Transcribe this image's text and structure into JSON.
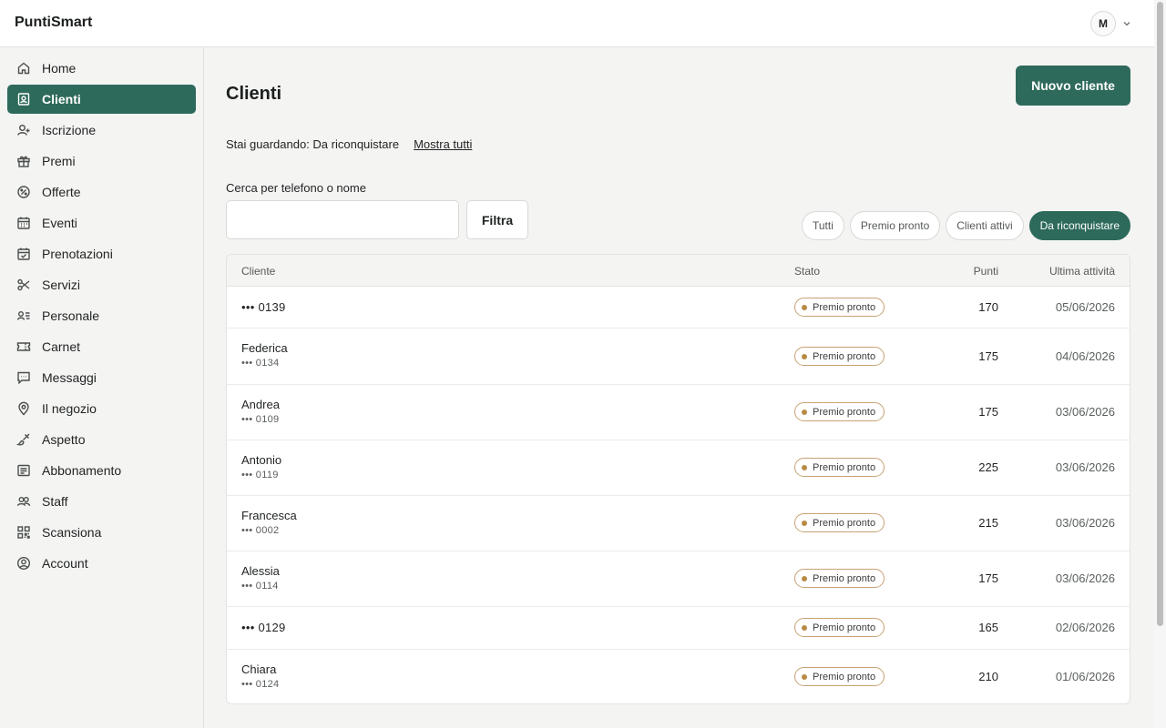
{
  "app": {
    "brand": "PuntiSmart",
    "user_initial": "M"
  },
  "sidebar": {
    "items": [
      {
        "label": "Home",
        "icon": "home-icon",
        "active": false
      },
      {
        "label": "Clienti",
        "icon": "clients-icon",
        "active": true
      },
      {
        "label": "Iscrizione",
        "icon": "user-add-icon",
        "active": false
      },
      {
        "label": "Premi",
        "icon": "gift-icon",
        "active": false
      },
      {
        "label": "Offerte",
        "icon": "discount-icon",
        "active": false
      },
      {
        "label": "Eventi",
        "icon": "calendar-icon",
        "active": false
      },
      {
        "label": "Prenotazioni",
        "icon": "calendar-check-icon",
        "active": false
      },
      {
        "label": "Servizi",
        "icon": "scissors-icon",
        "active": false
      },
      {
        "label": "Personale",
        "icon": "staff-list-icon",
        "active": false
      },
      {
        "label": "Carnet",
        "icon": "ticket-icon",
        "active": false
      },
      {
        "label": "Messaggi",
        "icon": "message-icon",
        "active": false
      },
      {
        "label": "Il negozio",
        "icon": "location-pin-icon",
        "active": false
      },
      {
        "label": "Aspetto",
        "icon": "brush-icon",
        "active": false
      },
      {
        "label": "Abbonamento",
        "icon": "subscription-icon",
        "active": false
      },
      {
        "label": "Staff",
        "icon": "users-icon",
        "active": false
      },
      {
        "label": "Scansiona",
        "icon": "qr-icon",
        "active": false
      },
      {
        "label": "Account",
        "icon": "account-icon",
        "active": false
      }
    ]
  },
  "main": {
    "title": "Clienti",
    "new_button": "Nuovo cliente",
    "viewing_text": "Stai guardando: Da riconquistare",
    "show_all": "Mostra tutti",
    "search_label": "Cerca per telefono o nome",
    "search_value": "",
    "filter_button": "Filtra",
    "chips": [
      {
        "label": "Tutti",
        "active": false
      },
      {
        "label": "Premio pronto",
        "active": false
      },
      {
        "label": "Clienti attivi",
        "active": false
      },
      {
        "label": "Da riconquistare",
        "active": true
      }
    ],
    "table": {
      "headers": {
        "client": "Cliente",
        "status": "Stato",
        "points": "Punti",
        "last_activity": "Ultima attività"
      },
      "rows": [
        {
          "name": "",
          "phone": "••• 0139",
          "status": "Premio pronto",
          "points": "170",
          "date": "05/06/2026"
        },
        {
          "name": "Federica",
          "phone": "••• 0134",
          "status": "Premio pronto",
          "points": "175",
          "date": "04/06/2026"
        },
        {
          "name": "Andrea",
          "phone": "••• 0109",
          "status": "Premio pronto",
          "points": "175",
          "date": "03/06/2026"
        },
        {
          "name": "Antonio",
          "phone": "••• 0119",
          "status": "Premio pronto",
          "points": "225",
          "date": "03/06/2026"
        },
        {
          "name": "Francesca",
          "phone": "••• 0002",
          "status": "Premio pronto",
          "points": "215",
          "date": "03/06/2026"
        },
        {
          "name": "Alessia",
          "phone": "••• 0114",
          "status": "Premio pronto",
          "points": "175",
          "date": "03/06/2026"
        },
        {
          "name": "",
          "phone": "••• 0129",
          "status": "Premio pronto",
          "points": "165",
          "date": "02/06/2026"
        },
        {
          "name": "Chiara",
          "phone": "••• 0124",
          "status": "Premio pronto",
          "points": "210",
          "date": "01/06/2026"
        }
      ]
    }
  },
  "colors": {
    "accent": "#2e6a5b",
    "badge_border": "#c8a173",
    "badge_dot": "#b98a45"
  }
}
